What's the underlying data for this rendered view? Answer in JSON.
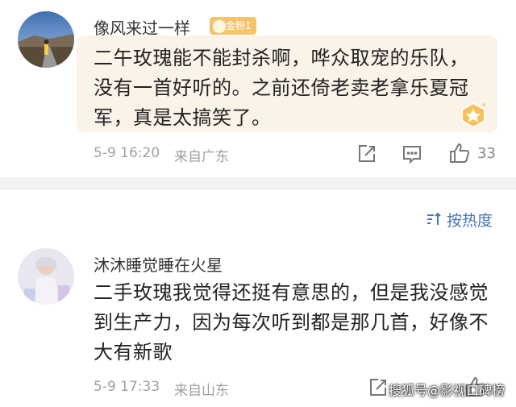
{
  "comments": [
    {
      "username": "像风来过一样",
      "badge": "金粉1",
      "lines": [
        "二午玫瑰能不能封杀啊，哗众取宠的乐队，",
        "没有一首好听的。之前还倚老卖老拿乐夏冠",
        "军，真是太搞笑了。"
      ],
      "date": "5-9 16:20",
      "location": "来自广东",
      "likes": "33"
    },
    {
      "username": "沐沐睡觉睡在火星",
      "lines": [
        "二手玫瑰我觉得还挺有意思的，但是我没感觉",
        "到生产力，因为每次听到都是那几首，好像不",
        "大有新歌"
      ],
      "date": "5-9 17:33",
      "location": "来自山东"
    }
  ],
  "sort": {
    "label": "按热度"
  },
  "watermark": "搜狐号@影视口碑榜",
  "colors": {
    "link": "#4a74b8",
    "card": "#fbf2e8",
    "badge": "#f4c36b",
    "meta": "#a0a0a0"
  }
}
